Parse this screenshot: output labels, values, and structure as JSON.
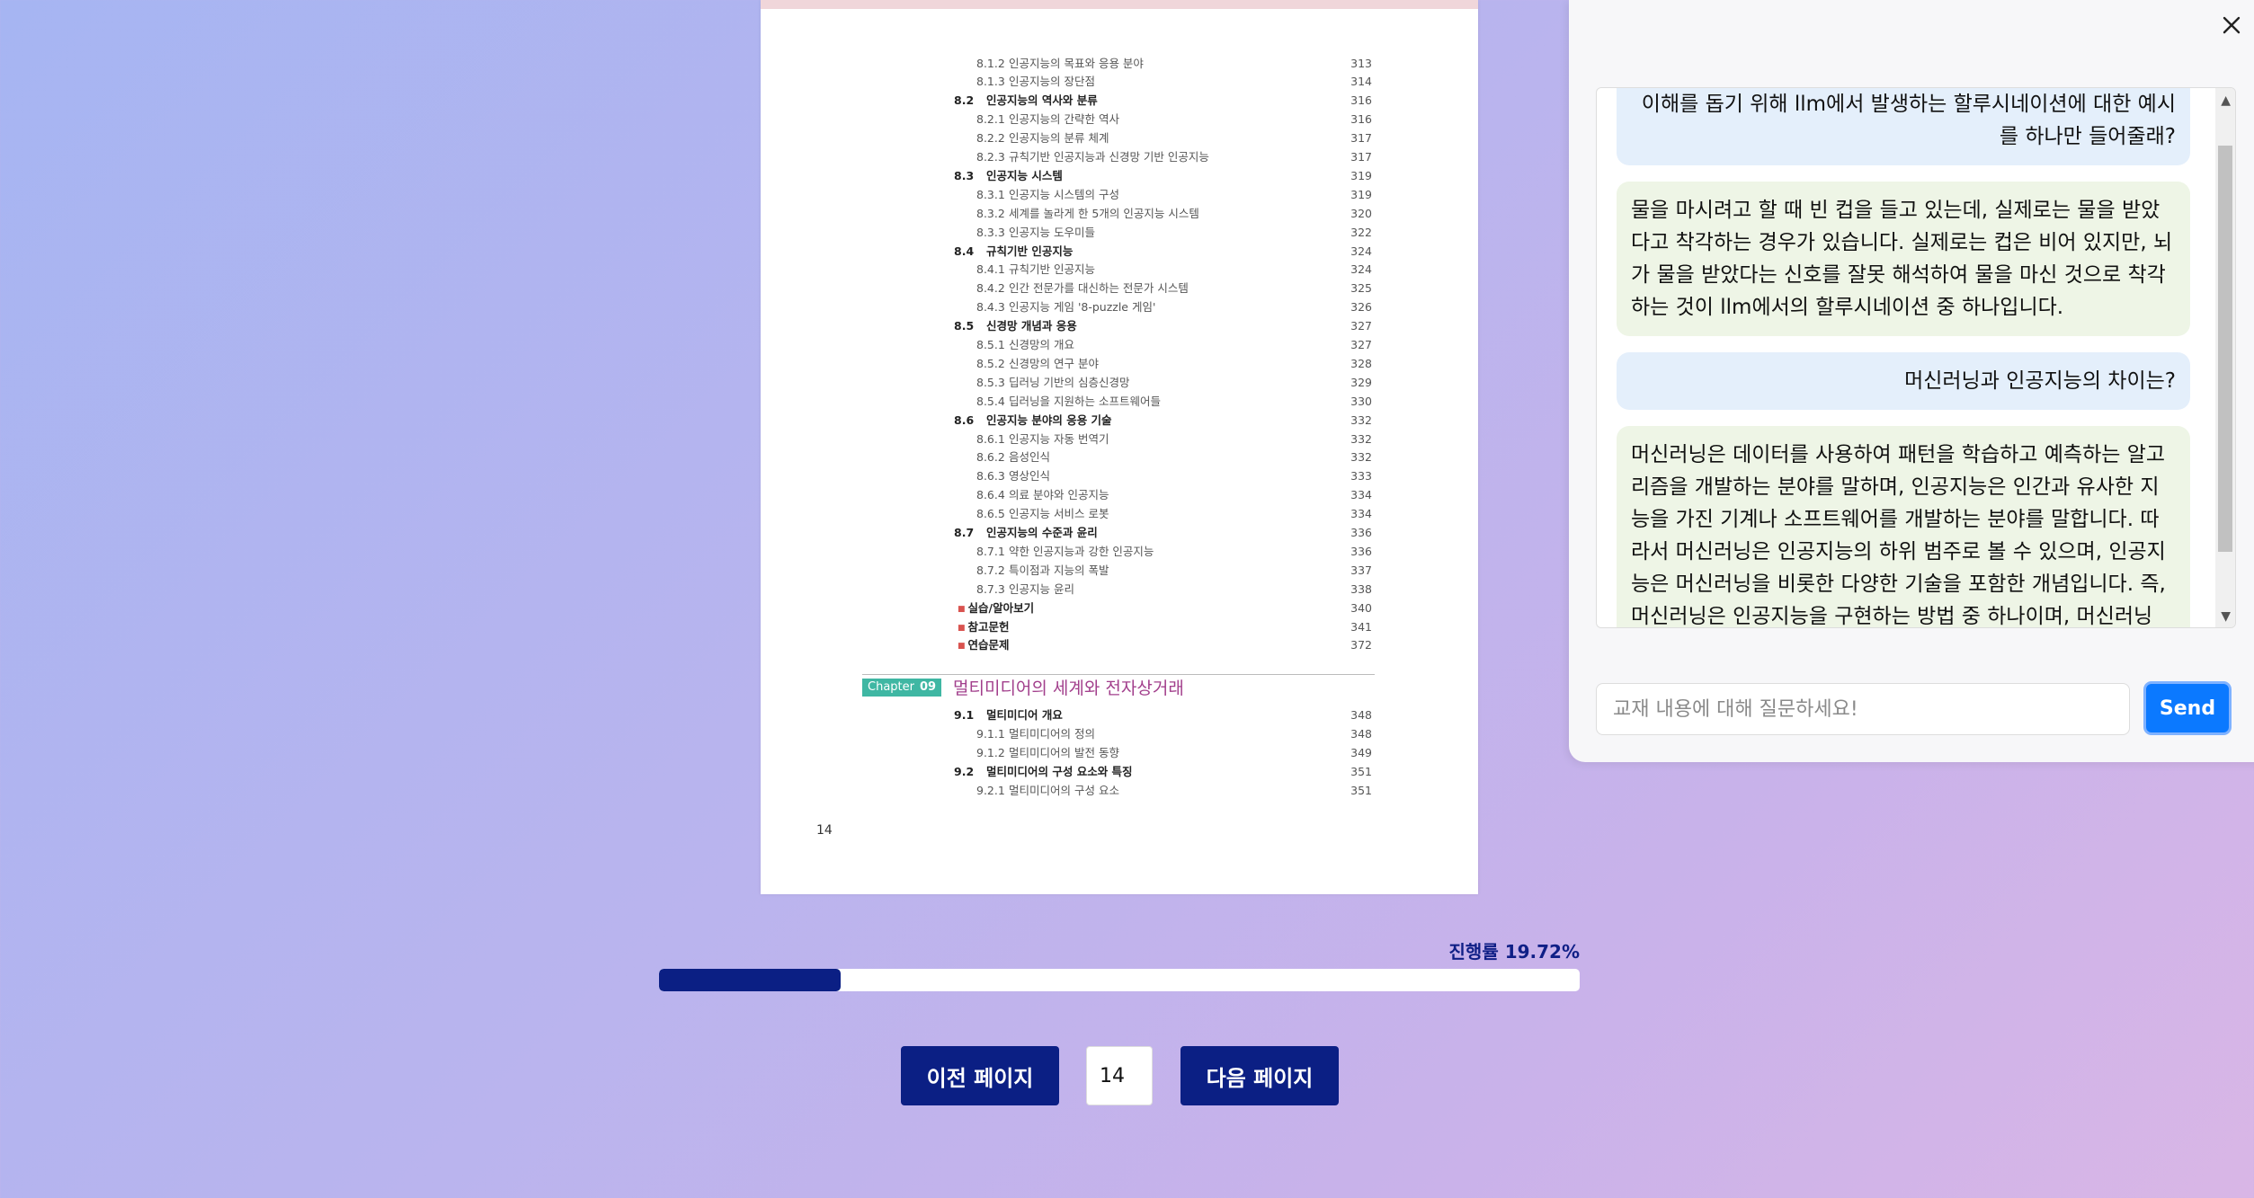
{
  "book": {
    "toc": [
      {
        "num": "8.1.2",
        "title": "인공지능의 목표와 응용 분야",
        "page": "313",
        "level": 2
      },
      {
        "num": "8.1.3",
        "title": "인공지능의 장단점",
        "page": "314",
        "level": 2
      },
      {
        "num": "8.2",
        "title": "인공지능의 역사와 분류",
        "page": "316",
        "level": 1
      },
      {
        "num": "8.2.1",
        "title": "인공지능의 간략한 역사",
        "page": "316",
        "level": 2
      },
      {
        "num": "8.2.2",
        "title": "인공지능의 분류 체계",
        "page": "317",
        "level": 2
      },
      {
        "num": "8.2.3",
        "title": "규칙기반 인공지능과 신경망 기반 인공지능",
        "page": "317",
        "level": 2
      },
      {
        "num": "8.3",
        "title": "인공지능 시스템",
        "page": "319",
        "level": 1
      },
      {
        "num": "8.3.1",
        "title": "인공지능 시스템의 구성",
        "page": "319",
        "level": 2
      },
      {
        "num": "8.3.2",
        "title": "세계를 놀라게 한 5개의 인공지능 시스템",
        "page": "320",
        "level": 2
      },
      {
        "num": "8.3.3",
        "title": "인공지능 도우미들",
        "page": "322",
        "level": 2
      },
      {
        "num": "8.4",
        "title": "규칙기반 인공지능",
        "page": "324",
        "level": 1
      },
      {
        "num": "8.4.1",
        "title": "규칙기반 인공지능",
        "page": "324",
        "level": 2
      },
      {
        "num": "8.4.2",
        "title": "인간 전문가를 대신하는 전문가 시스템",
        "page": "325",
        "level": 2
      },
      {
        "num": "8.4.3",
        "title": "인공지능 게임 '8-puzzle 게임'",
        "page": "326",
        "level": 2
      },
      {
        "num": "8.5",
        "title": "신경망 개념과 응용",
        "page": "327",
        "level": 1
      },
      {
        "num": "8.5.1",
        "title": "신경망의 개요",
        "page": "327",
        "level": 2
      },
      {
        "num": "8.5.2",
        "title": "신경망의 연구 분야",
        "page": "328",
        "level": 2
      },
      {
        "num": "8.5.3",
        "title": "딥러닝 기반의 심층신경망",
        "page": "329",
        "level": 2
      },
      {
        "num": "8.5.4",
        "title": "딥러닝을 지원하는 소프트웨어들",
        "page": "330",
        "level": 2
      },
      {
        "num": "8.6",
        "title": "인공지능 분야의 응용 기술",
        "page": "332",
        "level": 1
      },
      {
        "num": "8.6.1",
        "title": "인공지능 자동 번역기",
        "page": "332",
        "level": 2
      },
      {
        "num": "8.6.2",
        "title": "음성인식",
        "page": "332",
        "level": 2
      },
      {
        "num": "8.6.3",
        "title": "영상인식",
        "page": "333",
        "level": 2
      },
      {
        "num": "8.6.4",
        "title": "의료 분야와 인공지능",
        "page": "334",
        "level": 2
      },
      {
        "num": "8.6.5",
        "title": "인공지능 서비스 로봇",
        "page": "334",
        "level": 2
      },
      {
        "num": "8.7",
        "title": "인공지능의 수준과 윤리",
        "page": "336",
        "level": 1
      },
      {
        "num": "8.7.1",
        "title": "약한 인공지능과 강한 인공지능",
        "page": "336",
        "level": 2
      },
      {
        "num": "8.7.2",
        "title": "특이점과 지능의 폭발",
        "page": "337",
        "level": 2
      },
      {
        "num": "8.7.3",
        "title": "인공지능 윤리",
        "page": "338",
        "level": 2
      },
      {
        "num": "",
        "title": "실습/알아보기",
        "page": "340",
        "level": 0
      },
      {
        "num": "",
        "title": "참고문헌",
        "page": "341",
        "level": 0
      },
      {
        "num": "",
        "title": "연습문제",
        "page": "372",
        "level": 0
      }
    ],
    "chapter": {
      "tag": "Chapter",
      "num": "09",
      "title": "멀티미디어의 세계와 전자상거래"
    },
    "toc2": [
      {
        "num": "9.1",
        "title": "멀티미디어 개요",
        "page": "348",
        "level": 1
      },
      {
        "num": "9.1.1",
        "title": "멀티미디어의 정의",
        "page": "348",
        "level": 2
      },
      {
        "num": "9.1.2",
        "title": "멀티미디어의 발전 동향",
        "page": "349",
        "level": 2
      },
      {
        "num": "9.2",
        "title": "멀티미디어의 구성 요소와 특징",
        "page": "351",
        "level": 1
      },
      {
        "num": "9.2.1",
        "title": "멀티미디어의 구성 요소",
        "page": "351",
        "level": 2
      }
    ],
    "page_number": "14"
  },
  "progress": {
    "label": "진행률 19.72%",
    "value": 0.1972
  },
  "nav": {
    "prev_label": "이전 페이지",
    "next_label": "다음 페이지",
    "page_value": "14"
  },
  "chat": {
    "messages": [
      {
        "role": "user",
        "text": "이해를 돕기 위해 llm에서 발생하는 할루시네이션에 대한 예시를 하나만 들어줄래?"
      },
      {
        "role": "bot",
        "text": "물을 마시려고 할 때 빈 컵을 들고 있는데, 실제로는 물을 받았다고 착각하는 경우가 있습니다. 실제로는 컵은 비어 있지만, 뇌가 물을 받았다는 신호를 잘못 해석하여 물을 마신 것으로 착각하는 것이 llm에서의 할루시네이션 중 하나입니다."
      },
      {
        "role": "user",
        "text": "머신러닝과 인공지능의 차이는?"
      },
      {
        "role": "bot",
        "text": "머신러닝은 데이터를 사용하여 패턴을 학습하고 예측하는 알고리즘을 개발하는 분야를 말하며, 인공지능은 인간과 유사한 지능을 가진 기계나 소프트웨어를 개발하는 분야를 말합니다. 따라서 머신러닝은 인공지능의 하위 범주로 볼 수 있으며, 인공지능은 머신러닝을 비롯한 다양한 기술을 포함한 개념입니다. 즉, 머신러닝은 인공지능을 구현하는 방법 중 하나이며, 머신러닝 외에도 다양한 방법이 있습니다."
      }
    ],
    "input_placeholder": "교재 내용에 대해 질문하세요!",
    "send_label": "Send"
  },
  "icons": {
    "close": "close-icon",
    "scroll_up": "scroll-up-icon",
    "scroll_down": "scroll-down-icon"
  },
  "colors": {
    "accent": "#0b1f84",
    "send": "#0b79ff",
    "user_bubble": "#e4effb",
    "bot_bubble": "#eef5e6"
  }
}
